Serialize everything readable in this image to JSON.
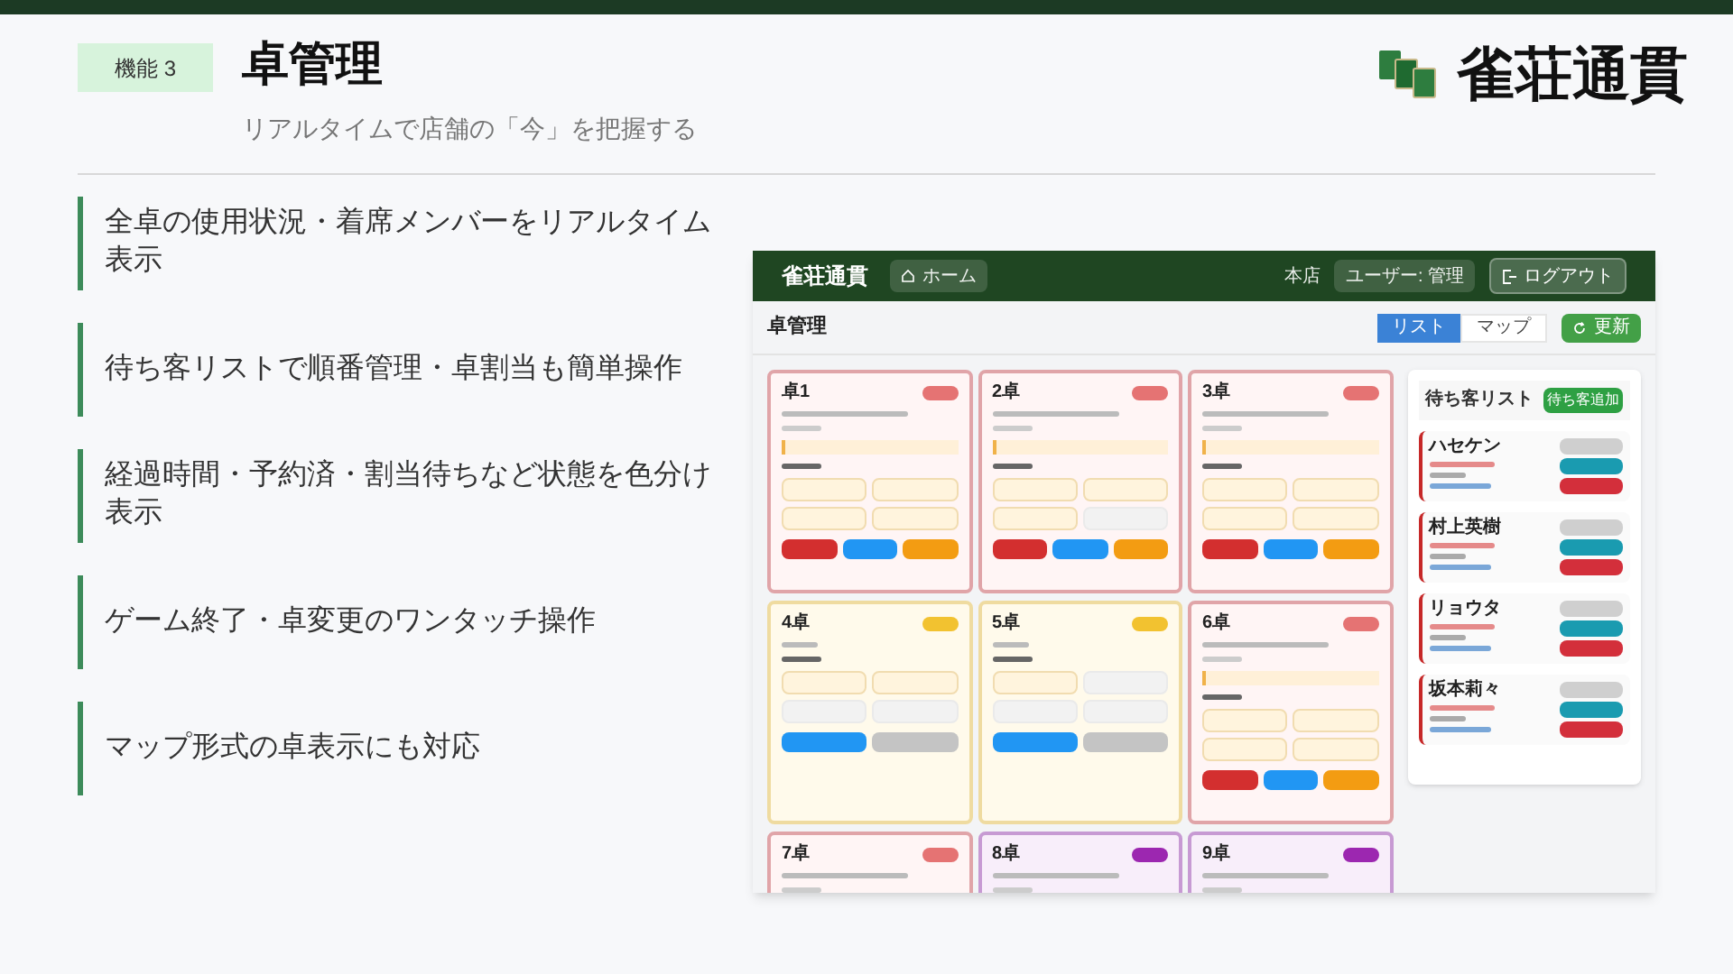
{
  "header": {
    "badge": "機能 3",
    "title": "卓管理",
    "subtitle": "リアルタイムで店舗の「今」を把握する",
    "logo": "雀荘通貫"
  },
  "features": [
    "全卓の使用状況・着席メンバーをリアルタイム表示",
    "待ち客リストで順番管理・卓割当も簡単操作",
    "経過時間・予約済・割当待ちなど状態を色分け表示",
    "ゲーム終了・卓変更のワンタッチ操作",
    "マップ形式の卓表示にも対応"
  ],
  "app": {
    "logo": "雀荘通貫",
    "home": "ホーム",
    "store": "本店",
    "user": "ユーザー: 管理",
    "logout": "ログアウト",
    "title": "卓管理",
    "view_tabs": [
      {
        "label": "リスト",
        "selected": true
      },
      {
        "label": "マップ",
        "selected": false
      }
    ],
    "refresh": "更新",
    "tables": [
      {
        "name": "卓1",
        "kind": "in_use",
        "seats": [
          {
            "occupied": true
          },
          {
            "occupied": true
          },
          {
            "occupied": true
          },
          {
            "occupied": true
          }
        ]
      },
      {
        "name": "2卓",
        "kind": "in_use",
        "seats": [
          {
            "occupied": true
          },
          {
            "occupied": true
          },
          {
            "occupied": true
          },
          {
            "occupied": false
          }
        ]
      },
      {
        "name": "3卓",
        "kind": "in_use",
        "seats": [
          {
            "occupied": true
          },
          {
            "occupied": true
          },
          {
            "occupied": true
          },
          {
            "occupied": true
          }
        ]
      },
      {
        "name": "4卓",
        "kind": "waiting",
        "seats": [
          {
            "occupied": true
          },
          {
            "occupied": true
          },
          {
            "occupied": false
          },
          {
            "occupied": false
          }
        ]
      },
      {
        "name": "5卓",
        "kind": "waiting",
        "seats": [
          {
            "occupied": true
          },
          {
            "occupied": false
          },
          {
            "occupied": false
          },
          {
            "occupied": false
          }
        ]
      },
      {
        "name": "6卓",
        "kind": "in_use",
        "seats": [
          {
            "occupied": true
          },
          {
            "occupied": true
          },
          {
            "occupied": true
          },
          {
            "occupied": true
          }
        ]
      },
      {
        "name": "7卓",
        "kind": "in_use"
      },
      {
        "name": "8卓",
        "kind": "reserved"
      },
      {
        "name": "9卓",
        "kind": "reserved"
      }
    ],
    "waitlist": {
      "title": "待ち客リスト",
      "add": "待ち客追加",
      "guests": [
        {
          "name": "ハセケン"
        },
        {
          "name": "村上英樹"
        },
        {
          "name": "リョウタ"
        },
        {
          "name": "坂本莉々"
        }
      ]
    }
  }
}
